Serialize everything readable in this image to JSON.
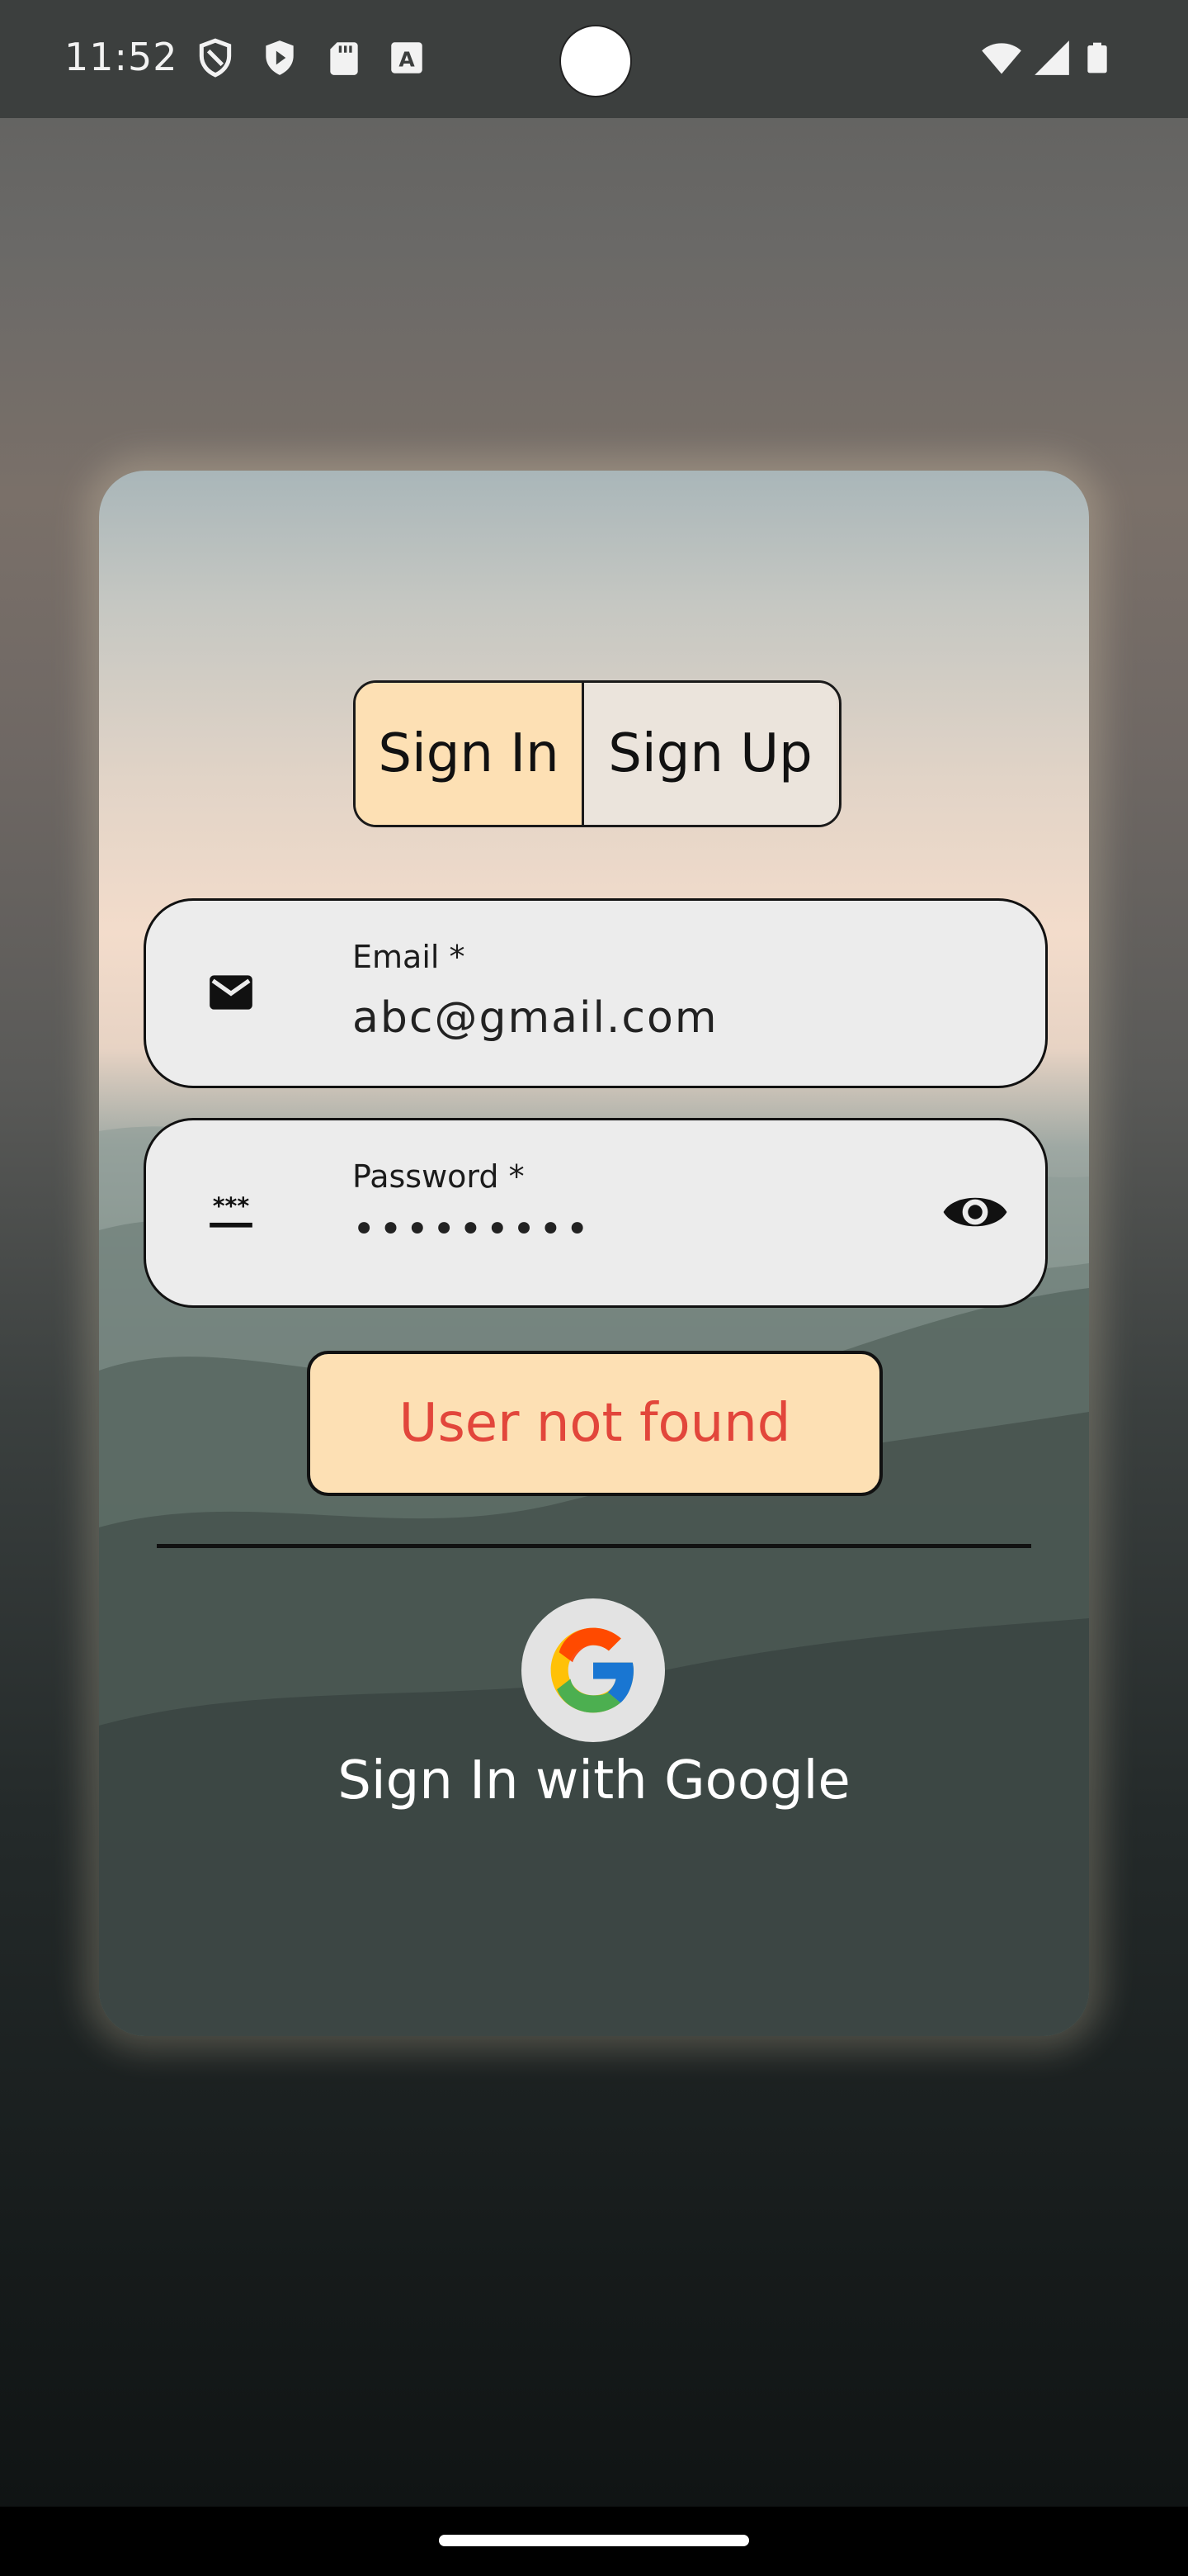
{
  "status_bar": {
    "time": "11:52",
    "icons": [
      "shield-outline-icon",
      "play-shield-icon",
      "sd-card-icon",
      "font-a-icon",
      "wifi-icon",
      "signal-icon",
      "battery-icon"
    ]
  },
  "auth_toggle": {
    "sign_in_label": "Sign In",
    "sign_up_label": "Sign Up",
    "selected": "Sign In",
    "selected_color": "#fde0b4"
  },
  "email_field": {
    "label": "Email *",
    "value": "abc@gmail.com",
    "icon": "mail-icon"
  },
  "password_field": {
    "label": "Password *",
    "value": "•••••••••",
    "icon": "password-icon",
    "toggle_icon": "eye-icon"
  },
  "error_button": {
    "label": "User not found",
    "text_color": "#e2463b",
    "background": "#fde0b4"
  },
  "google_sign_in": {
    "label": "Sign In with Google",
    "icon": "google-g-icon"
  }
}
